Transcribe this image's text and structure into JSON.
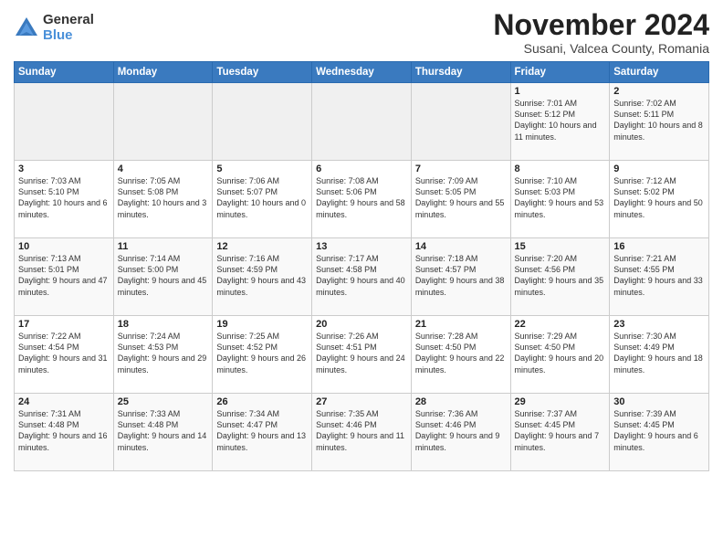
{
  "logo": {
    "general": "General",
    "blue": "Blue"
  },
  "header": {
    "title": "November 2024",
    "subtitle": "Susani, Valcea County, Romania"
  },
  "weekdays": [
    "Sunday",
    "Monday",
    "Tuesday",
    "Wednesday",
    "Thursday",
    "Friday",
    "Saturday"
  ],
  "weeks": [
    [
      {
        "day": "",
        "info": ""
      },
      {
        "day": "",
        "info": ""
      },
      {
        "day": "",
        "info": ""
      },
      {
        "day": "",
        "info": ""
      },
      {
        "day": "",
        "info": ""
      },
      {
        "day": "1",
        "info": "Sunrise: 7:01 AM\nSunset: 5:12 PM\nDaylight: 10 hours and 11 minutes."
      },
      {
        "day": "2",
        "info": "Sunrise: 7:02 AM\nSunset: 5:11 PM\nDaylight: 10 hours and 8 minutes."
      }
    ],
    [
      {
        "day": "3",
        "info": "Sunrise: 7:03 AM\nSunset: 5:10 PM\nDaylight: 10 hours and 6 minutes."
      },
      {
        "day": "4",
        "info": "Sunrise: 7:05 AM\nSunset: 5:08 PM\nDaylight: 10 hours and 3 minutes."
      },
      {
        "day": "5",
        "info": "Sunrise: 7:06 AM\nSunset: 5:07 PM\nDaylight: 10 hours and 0 minutes."
      },
      {
        "day": "6",
        "info": "Sunrise: 7:08 AM\nSunset: 5:06 PM\nDaylight: 9 hours and 58 minutes."
      },
      {
        "day": "7",
        "info": "Sunrise: 7:09 AM\nSunset: 5:05 PM\nDaylight: 9 hours and 55 minutes."
      },
      {
        "day": "8",
        "info": "Sunrise: 7:10 AM\nSunset: 5:03 PM\nDaylight: 9 hours and 53 minutes."
      },
      {
        "day": "9",
        "info": "Sunrise: 7:12 AM\nSunset: 5:02 PM\nDaylight: 9 hours and 50 minutes."
      }
    ],
    [
      {
        "day": "10",
        "info": "Sunrise: 7:13 AM\nSunset: 5:01 PM\nDaylight: 9 hours and 47 minutes."
      },
      {
        "day": "11",
        "info": "Sunrise: 7:14 AM\nSunset: 5:00 PM\nDaylight: 9 hours and 45 minutes."
      },
      {
        "day": "12",
        "info": "Sunrise: 7:16 AM\nSunset: 4:59 PM\nDaylight: 9 hours and 43 minutes."
      },
      {
        "day": "13",
        "info": "Sunrise: 7:17 AM\nSunset: 4:58 PM\nDaylight: 9 hours and 40 minutes."
      },
      {
        "day": "14",
        "info": "Sunrise: 7:18 AM\nSunset: 4:57 PM\nDaylight: 9 hours and 38 minutes."
      },
      {
        "day": "15",
        "info": "Sunrise: 7:20 AM\nSunset: 4:56 PM\nDaylight: 9 hours and 35 minutes."
      },
      {
        "day": "16",
        "info": "Sunrise: 7:21 AM\nSunset: 4:55 PM\nDaylight: 9 hours and 33 minutes."
      }
    ],
    [
      {
        "day": "17",
        "info": "Sunrise: 7:22 AM\nSunset: 4:54 PM\nDaylight: 9 hours and 31 minutes."
      },
      {
        "day": "18",
        "info": "Sunrise: 7:24 AM\nSunset: 4:53 PM\nDaylight: 9 hours and 29 minutes."
      },
      {
        "day": "19",
        "info": "Sunrise: 7:25 AM\nSunset: 4:52 PM\nDaylight: 9 hours and 26 minutes."
      },
      {
        "day": "20",
        "info": "Sunrise: 7:26 AM\nSunset: 4:51 PM\nDaylight: 9 hours and 24 minutes."
      },
      {
        "day": "21",
        "info": "Sunrise: 7:28 AM\nSunset: 4:50 PM\nDaylight: 9 hours and 22 minutes."
      },
      {
        "day": "22",
        "info": "Sunrise: 7:29 AM\nSunset: 4:50 PM\nDaylight: 9 hours and 20 minutes."
      },
      {
        "day": "23",
        "info": "Sunrise: 7:30 AM\nSunset: 4:49 PM\nDaylight: 9 hours and 18 minutes."
      }
    ],
    [
      {
        "day": "24",
        "info": "Sunrise: 7:31 AM\nSunset: 4:48 PM\nDaylight: 9 hours and 16 minutes."
      },
      {
        "day": "25",
        "info": "Sunrise: 7:33 AM\nSunset: 4:48 PM\nDaylight: 9 hours and 14 minutes."
      },
      {
        "day": "26",
        "info": "Sunrise: 7:34 AM\nSunset: 4:47 PM\nDaylight: 9 hours and 13 minutes."
      },
      {
        "day": "27",
        "info": "Sunrise: 7:35 AM\nSunset: 4:46 PM\nDaylight: 9 hours and 11 minutes."
      },
      {
        "day": "28",
        "info": "Sunrise: 7:36 AM\nSunset: 4:46 PM\nDaylight: 9 hours and 9 minutes."
      },
      {
        "day": "29",
        "info": "Sunrise: 7:37 AM\nSunset: 4:45 PM\nDaylight: 9 hours and 7 minutes."
      },
      {
        "day": "30",
        "info": "Sunrise: 7:39 AM\nSunset: 4:45 PM\nDaylight: 9 hours and 6 minutes."
      }
    ]
  ]
}
